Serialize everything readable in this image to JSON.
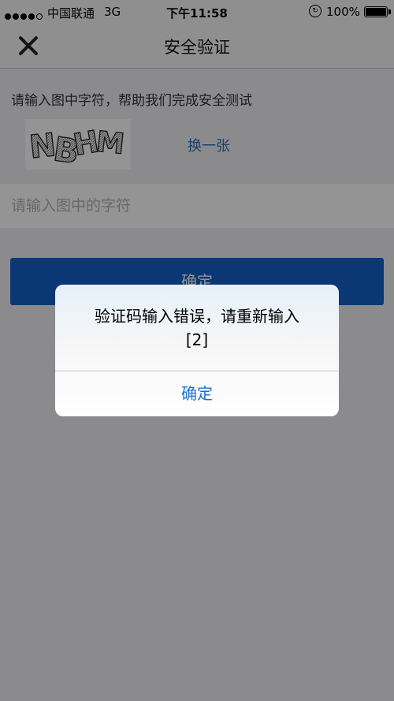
{
  "status_bar": {
    "carrier": "中国联通",
    "network": "3G",
    "time": "下午11:58",
    "battery": "100%"
  },
  "nav": {
    "title": "安全验证",
    "close_icon": "close-icon"
  },
  "form": {
    "prompt": "请输入图中字符，帮助我们完成安全测试",
    "captcha_text": "NBHM",
    "refresh_label": "换一张",
    "input_value": "",
    "input_placeholder": "请输入图中的字符",
    "submit_label": "确定"
  },
  "alert": {
    "line1": "验证码输入错误，请重新输入",
    "line2": "[2]",
    "ok_label": "确定"
  },
  "colors": {
    "primary_button": "#1461c8",
    "link": "#2f6fc0",
    "alert_button": "#1a73d0"
  }
}
